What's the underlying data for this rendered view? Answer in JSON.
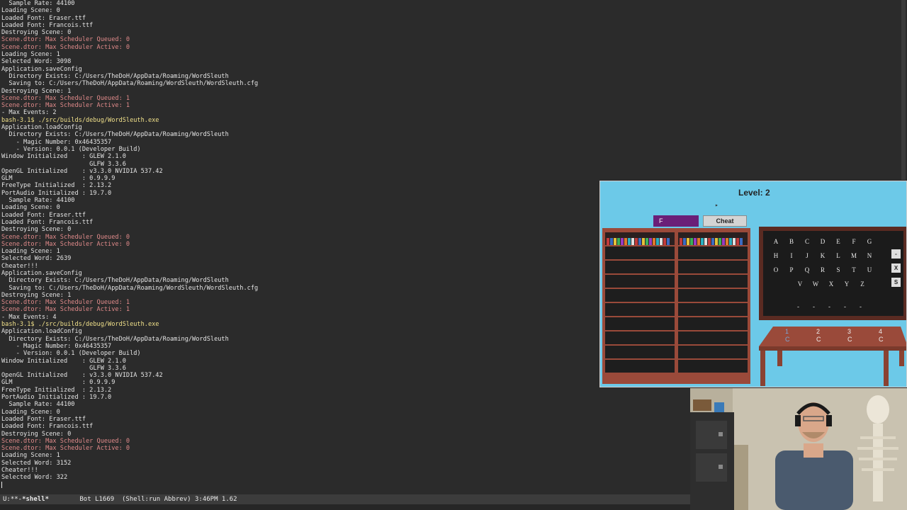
{
  "terminal": {
    "lines": [
      {
        "t": "  Sample Rate: 44100",
        "k": ""
      },
      {
        "t": "Loading Scene: 0",
        "k": ""
      },
      {
        "t": "Loaded Font: Eraser.ttf",
        "k": ""
      },
      {
        "t": "Loaded Font: Francois.ttf",
        "k": ""
      },
      {
        "t": "Destroying Scene: 0",
        "k": ""
      },
      {
        "t": "Scene.dtor: Max Scheduler Queued: 0",
        "k": "err"
      },
      {
        "t": "Scene.dtor: Max Scheduler Active: 0",
        "k": "err"
      },
      {
        "t": "Loading Scene: 1",
        "k": ""
      },
      {
        "t": "Selected Word: 3098",
        "k": ""
      },
      {
        "t": "Application.saveConfig",
        "k": ""
      },
      {
        "t": "  Directory Exists: C:/Users/TheDoH/AppData/Roaming/WordSleuth",
        "k": ""
      },
      {
        "t": "  Saving to: C:/Users/TheDoH/AppData/Roaming/WordSleuth/WordSleuth.cfg",
        "k": ""
      },
      {
        "t": "Destroying Scene: 1",
        "k": ""
      },
      {
        "t": "Scene.dtor: Max Scheduler Queued: 1",
        "k": "err"
      },
      {
        "t": "Scene.dtor: Max Scheduler Active: 1",
        "k": "err"
      },
      {
        "t": "- Max Events: 2",
        "k": ""
      },
      {
        "t": "bash-3.1$ ./src/builds/debug/WordSleuth.exe",
        "k": "prompt"
      },
      {
        "t": "Application.loadConfig",
        "k": ""
      },
      {
        "t": "  Directory Exists: C:/Users/TheDoH/AppData/Roaming/WordSleuth",
        "k": ""
      },
      {
        "t": "    - Magic Number: 0x46435357",
        "k": ""
      },
      {
        "t": "    - Version: 0.0.1 (Developer Build)",
        "k": ""
      },
      {
        "t": "Window Initialized    : GLEW 2.1.0",
        "k": ""
      },
      {
        "t": "                        GLFW 3.3.6",
        "k": ""
      },
      {
        "t": "OpenGL Initialized    : v3.3.0 NVIDIA 537.42",
        "k": ""
      },
      {
        "t": "GLM                   : 0.9.9.9",
        "k": ""
      },
      {
        "t": "FreeType Initialized  : 2.13.2",
        "k": ""
      },
      {
        "t": "PortAudio Initialized : 19.7.0",
        "k": ""
      },
      {
        "t": "  Sample Rate: 44100",
        "k": ""
      },
      {
        "t": "Loading Scene: 0",
        "k": ""
      },
      {
        "t": "Loaded Font: Eraser.ttf",
        "k": ""
      },
      {
        "t": "Loaded Font: Francois.ttf",
        "k": ""
      },
      {
        "t": "Destroying Scene: 0",
        "k": ""
      },
      {
        "t": "Scene.dtor: Max Scheduler Queued: 0",
        "k": "err"
      },
      {
        "t": "Scene.dtor: Max Scheduler Active: 0",
        "k": "err"
      },
      {
        "t": "Loading Scene: 1",
        "k": ""
      },
      {
        "t": "Selected Word: 2639",
        "k": ""
      },
      {
        "t": "Cheater!!!",
        "k": ""
      },
      {
        "t": "Application.saveConfig",
        "k": ""
      },
      {
        "t": "  Directory Exists: C:/Users/TheDoH/AppData/Roaming/WordSleuth",
        "k": ""
      },
      {
        "t": "  Saving to: C:/Users/TheDoH/AppData/Roaming/WordSleuth/WordSleuth.cfg",
        "k": ""
      },
      {
        "t": "Destroying Scene: 1",
        "k": ""
      },
      {
        "t": "Scene.dtor: Max Scheduler Queued: 1",
        "k": "err"
      },
      {
        "t": "Scene.dtor: Max Scheduler Active: 1",
        "k": "err"
      },
      {
        "t": "- Max Events: 4",
        "k": ""
      },
      {
        "t": "bash-3.1$ ./src/builds/debug/WordSleuth.exe",
        "k": "prompt"
      },
      {
        "t": "Application.loadConfig",
        "k": ""
      },
      {
        "t": "  Directory Exists: C:/Users/TheDoH/AppData/Roaming/WordSleuth",
        "k": ""
      },
      {
        "t": "    - Magic Number: 0x46435357",
        "k": ""
      },
      {
        "t": "    - Version: 0.0.1 (Developer Build)",
        "k": ""
      },
      {
        "t": "Window Initialized    : GLEW 2.1.0",
        "k": ""
      },
      {
        "t": "                        GLFW 3.3.6",
        "k": ""
      },
      {
        "t": "OpenGL Initialized    : v3.3.0 NVIDIA 537.42",
        "k": ""
      },
      {
        "t": "GLM                   : 0.9.9.9",
        "k": ""
      },
      {
        "t": "FreeType Initialized  : 2.13.2",
        "k": ""
      },
      {
        "t": "PortAudio Initialized : 19.7.0",
        "k": ""
      },
      {
        "t": "  Sample Rate: 44100",
        "k": ""
      },
      {
        "t": "Loading Scene: 0",
        "k": ""
      },
      {
        "t": "Loaded Font: Eraser.ttf",
        "k": ""
      },
      {
        "t": "Loaded Font: Francois.ttf",
        "k": ""
      },
      {
        "t": "Destroying Scene: 0",
        "k": ""
      },
      {
        "t": "Scene.dtor: Max Scheduler Queued: 0",
        "k": "err"
      },
      {
        "t": "Scene.dtor: Max Scheduler Active: 0",
        "k": "err"
      },
      {
        "t": "Loading Scene: 1",
        "k": ""
      },
      {
        "t": "Selected Word: 3152",
        "k": ""
      },
      {
        "t": "Cheater!!!",
        "k": ""
      },
      {
        "t": "Selected Word: 322",
        "k": ""
      }
    ]
  },
  "modeline": {
    "status": "U:**-",
    "buffer": "*shell*",
    "position": "Bot L1669",
    "mode": "(Shell:run Abbrev)",
    "time": "3:46PM 1.62"
  },
  "game": {
    "level": "Level: 2",
    "guess_text": "F",
    "cheat_label": "Cheat",
    "letter_rows": [
      [
        "A",
        "B",
        "C",
        "D",
        "E",
        "F",
        "G"
      ],
      [
        "H",
        "I",
        "J",
        "K",
        "L",
        "M",
        "N"
      ],
      [
        "O",
        "P",
        "Q",
        "R",
        "S",
        "T",
        "U"
      ],
      [
        "V",
        "W",
        "X",
        "Y",
        "Z"
      ]
    ],
    "side_buttons": [
      "-",
      "X",
      "S"
    ],
    "word_blanks": [
      "-",
      "-",
      "-",
      "-",
      "-"
    ],
    "desk_slots": [
      {
        "num": "1",
        "sub": "C"
      },
      {
        "num": "2",
        "sub": "C"
      },
      {
        "num": "3",
        "sub": "C"
      },
      {
        "num": "4",
        "sub": "C"
      }
    ]
  },
  "colors": {
    "game_bg": "#6cc9e8",
    "guess_box": "#6a1f78",
    "bookshelf": "#9a4a3a",
    "error_text": "#e08a8a",
    "prompt_text": "#f0e08a"
  }
}
